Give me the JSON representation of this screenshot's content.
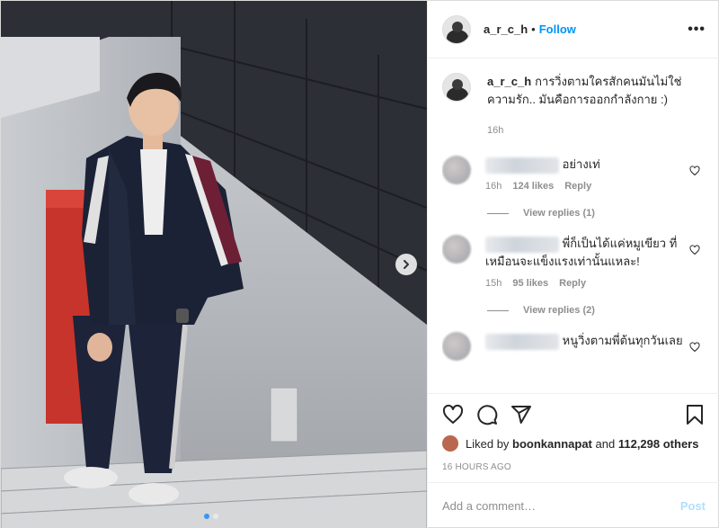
{
  "post": {
    "username": "a_r_c_h",
    "separator": "•",
    "follow_label": "Follow",
    "more_label": "•••",
    "caption_username": "a_r_c_h",
    "caption_text": "การวิ่งตามใครสักคนมันไม่ใช่ความรัก.. มันคือการออกกำลังกาย :)",
    "caption_age": "16h"
  },
  "comments": [
    {
      "text": "อย่างเท่",
      "age": "16h",
      "likes": "124 likes",
      "reply_label": "Reply",
      "view_replies": "View replies (1)"
    },
    {
      "text": "พี่ก็เป็นได้แค่หมูเขียว ที่เหมือนจะแข็งแรงเท่านั้นแหละ!",
      "age": "15h",
      "likes": "95 likes",
      "reply_label": "Reply",
      "view_replies": "View replies (2)"
    },
    {
      "text": "หนูวิ่งตามพี่ต้นทุกวันเลย"
    }
  ],
  "likes": {
    "prefix": "Liked by",
    "user": "boonkannapat",
    "and": "and",
    "count": "112,298 others"
  },
  "timestamp": "16 HOURS AGO",
  "comment_box": {
    "placeholder": "Add a comment…",
    "post_label": "Post"
  },
  "carousel": {
    "total": 2,
    "current": 1
  },
  "colors": {
    "accent": "#0095f6",
    "post_disabled": "#b2dffc",
    "muted": "#8e8e8e"
  },
  "icons": [
    "heart-icon",
    "comment-icon",
    "share-icon",
    "bookmark-icon",
    "chevron-right-icon",
    "more-icon"
  ]
}
